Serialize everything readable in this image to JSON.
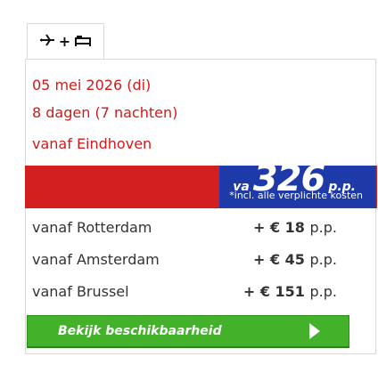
{
  "tabs": [
    {
      "icons": [
        "plane-icon",
        "plus-icon",
        "bed-icon"
      ],
      "plus_symbol": "+"
    }
  ],
  "trip": {
    "date": "05 mei 2026 (di)",
    "duration": "8 dagen (7 nachten)",
    "origin": "vanaf Eindhoven"
  },
  "price": {
    "prefix": "va",
    "amount": "326",
    "suffix": "p.p.",
    "note": "*incl. alle verplichte kosten"
  },
  "departures": [
    {
      "label": "vanaf Rotterdam",
      "value": "+ € 18",
      "unit": "p.p."
    },
    {
      "label": "vanaf Amsterdam",
      "value": "+ € 45",
      "unit": "p.p."
    },
    {
      "label": "vanaf Brussel",
      "value": "+ € 151",
      "unit": "p.p."
    }
  ],
  "cta": {
    "label": "Bekijk beschikbaarheid"
  },
  "colors": {
    "red": "#d31f1f",
    "blue": "#1d3aa8",
    "green": "#43b12a"
  }
}
